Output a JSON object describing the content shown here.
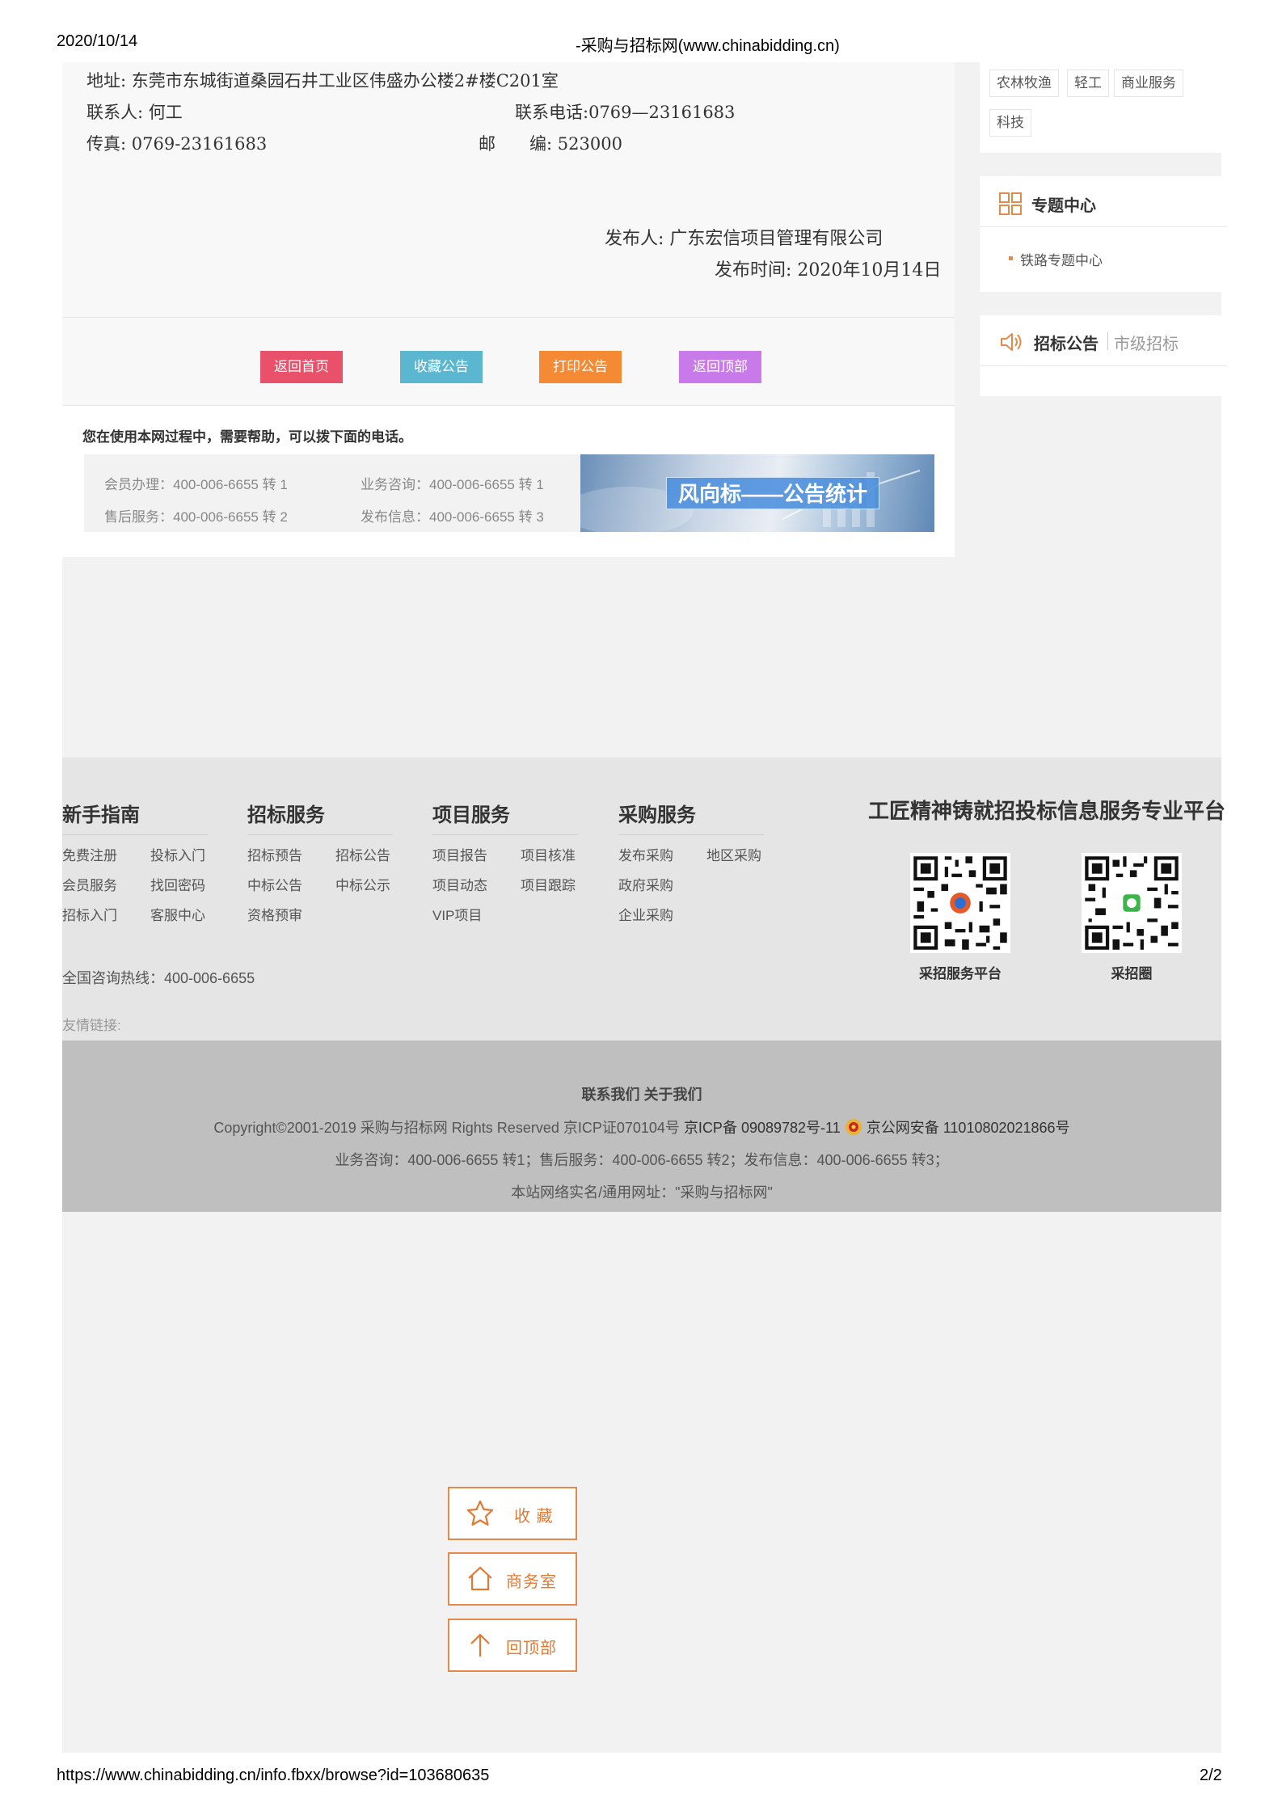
{
  "print": {
    "date": "2020/10/14",
    "title": "-采购与招标网(www.chinabidding.cn)",
    "url": "https://www.chinabidding.cn/info.fbxx/browse?id=103680635",
    "page": "2/2"
  },
  "notice": {
    "address_label": "地址:",
    "address": "东莞市东城街道桑园石井工业区伟盛办公楼2#楼C201室",
    "contact_label": "联系人:",
    "contact": "何工",
    "phone_label": "联系电话:",
    "phone": "0769—23161683",
    "fax_label": "传真:",
    "fax": "0769-23161683",
    "postal_label": "邮　　编:",
    "postal": "523000",
    "publisher_label": "发布人:",
    "publisher": "广东宏信项目管理有限公司",
    "publish_time_label": "发布时间:",
    "publish_time": "2020年10月14日"
  },
  "actions": {
    "home": "返回首页",
    "favorite": "收藏公告",
    "print": "打印公告",
    "top": "返回顶部",
    "colors": {
      "home": "#e9506a",
      "favorite": "#5bb7cf",
      "print": "#f48a34",
      "top": "#c77ae8"
    }
  },
  "help": {
    "title": "您在使用本网过程中，需要帮助，可以拨下面的电话。",
    "member": "会员办理：400-006-6655 转 1",
    "consult": "业务咨询：400-006-6655 转 1",
    "aftersale": "售后服务：400-006-6655 转 2",
    "publish": "发布信息：400-006-6655 转 3",
    "banner": "风向标——公告统计"
  },
  "sidebar": {
    "tags": [
      "农林牧渔",
      "轻工",
      "商业服务",
      "科技"
    ],
    "topic_title": "专题中心",
    "topic_item": "铁路专题中心",
    "bid_title": "招标公告",
    "bid_sub": "市级招标"
  },
  "footer": {
    "cols": [
      {
        "title": "新手指南",
        "links": [
          "免费注册",
          "投标入门",
          "会员服务",
          "找回密码",
          "招标入门",
          "客服中心"
        ]
      },
      {
        "title": "招标服务",
        "links": [
          "招标预告",
          "招标公告",
          "中标公告",
          "中标公示",
          "资格预审"
        ]
      },
      {
        "title": "项目服务",
        "links": [
          "项目报告",
          "项目核准",
          "项目动态",
          "项目跟踪",
          "VIP项目"
        ]
      },
      {
        "title": "采购服务",
        "links": [
          "发布采购",
          "地区采购",
          "政府采购",
          "企业采购"
        ]
      }
    ],
    "slogan": "工匠精神铸就招投标信息服务专业平台",
    "qr1_label": "采招服务平台",
    "qr2_label": "采招圈",
    "hotline": "全国咨询热线：400-006-6655",
    "friends": "友情链接:"
  },
  "copyright": {
    "contact": "联系我们",
    "about": "关于我们",
    "line1_a": "Copyright©2001-2019 采购与招标网 Rights Reserved 京ICP证070104号",
    "line1_b": "京ICP备 09089782号-11",
    "line1_c": "京公网安备 11010802021866号",
    "line2": "业务咨询：400-006-6655 转1；售后服务：400-006-6655 转2；发布信息：400-006-6655 转3；",
    "line3": "本站网络实名/通用网址：\"采购与招标网\""
  },
  "float": {
    "favorite": "收 藏",
    "office": "商务室",
    "top": "回顶部"
  }
}
